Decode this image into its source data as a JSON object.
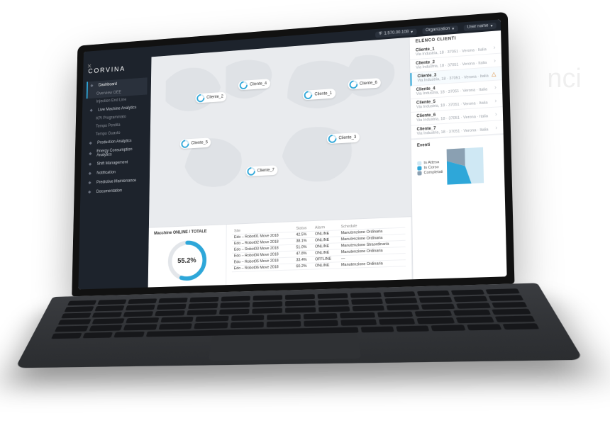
{
  "brand": {
    "logo": "CORVINA"
  },
  "topbar": {
    "ip": "1.570.00.108",
    "org": "Organization",
    "user": "User name"
  },
  "sidebar": {
    "items": [
      {
        "label": "Dashboard",
        "active": true
      },
      {
        "label": "Overview OEE",
        "sub": true,
        "active": true
      },
      {
        "label": "Injection End Line",
        "sub": true
      },
      {
        "label": "Live Machine Analytics"
      },
      {
        "label": "KPI Programmato",
        "sub": true
      },
      {
        "label": "Tempo Perdita",
        "sub": true
      },
      {
        "label": "Tempo Guasto",
        "sub": true
      },
      {
        "label": "Production Analytics"
      },
      {
        "label": "Energy Consumption Analytics"
      },
      {
        "label": "Shift Management"
      },
      {
        "label": "Notification"
      },
      {
        "label": "Predictive Maintenance"
      },
      {
        "label": "Documentation"
      }
    ]
  },
  "map": {
    "markers": [
      {
        "label": "Cliente_2",
        "x": 18,
        "y": 24
      },
      {
        "label": "Cliente_4",
        "x": 35,
        "y": 18
      },
      {
        "label": "Cliente_1",
        "x": 60,
        "y": 26
      },
      {
        "label": "Cliente_6",
        "x": 77,
        "y": 22
      },
      {
        "label": "Cliente_5",
        "x": 12,
        "y": 50
      },
      {
        "label": "Cliente_3",
        "x": 69,
        "y": 52
      },
      {
        "label": "Cliente_7",
        "x": 38,
        "y": 68
      }
    ]
  },
  "gauge": {
    "title": "Macchine ONLINE / TOTALE",
    "value_pct": 55.2
  },
  "table": {
    "headers": [
      "Site",
      "Status",
      "Alarm",
      "Schedule"
    ],
    "rows": [
      [
        "Edo – Robot01 Move 2018",
        "42.5%",
        "ONLINE",
        "Manutenzione Ordinaria"
      ],
      [
        "Edo – Robot02 Move 2018",
        "38.1%",
        "ONLINE",
        "Manutenzione Ordinaria"
      ],
      [
        "Edo – Robot03 Move 2018",
        "51.0%",
        "ONLINE",
        "Manutenzione Straordinaria"
      ],
      [
        "Edo – Robot04 Move 2018",
        "47.8%",
        "ONLINE",
        "Manutenzione Ordinaria"
      ],
      [
        "Edo – Robot05 Move 2018",
        "33.4%",
        "OFFLINE",
        "—"
      ],
      [
        "Edo – Robot06 Move 2018",
        "60.2%",
        "ONLINE",
        "Manutenzione Ordinaria"
      ]
    ]
  },
  "clients": {
    "title": "ELENCO CLIENTI",
    "items": [
      {
        "name": "Cliente_1",
        "meta": "Via Industria, 18 · 37051 · Verona · Italia"
      },
      {
        "name": "Cliente_2",
        "meta": "Via Industria, 18 · 37051 · Verona · Italia"
      },
      {
        "name": "Cliente_3",
        "meta": "Via Industria, 18 · 37051 · Verona · Italia",
        "warn": true,
        "selected": true
      },
      {
        "name": "Cliente_4",
        "meta": "Via Industria, 18 · 37051 · Verona · Italia"
      },
      {
        "name": "Cliente_5",
        "meta": "Via Industria, 18 · 37051 · Verona · Italia"
      },
      {
        "name": "Cliente_6",
        "meta": "Via Industria, 18 · 37051 · Verona · Italia"
      },
      {
        "name": "Cliente_7",
        "meta": "Via Industria, 18 · 37051 · Verona · Italia"
      }
    ]
  },
  "pie": {
    "title": "Eventi",
    "legend": [
      {
        "label": "In Attesa",
        "color": "#cfe8f4"
      },
      {
        "label": "In Corso",
        "color": "#2ea7d9"
      },
      {
        "label": "Completati",
        "color": "#8aa0b2"
      }
    ]
  },
  "chart_data": [
    {
      "type": "pie",
      "title": "Eventi",
      "series": [
        {
          "name": "In Attesa",
          "value": 45
        },
        {
          "name": "In Corso",
          "value": 35
        },
        {
          "name": "Completati",
          "value": 20
        }
      ]
    },
    {
      "type": "gauge",
      "title": "Macchine ONLINE / TOTALE",
      "value": 55.2,
      "min": 0,
      "max": 100,
      "unit": "%"
    }
  ],
  "watermark": "nci"
}
